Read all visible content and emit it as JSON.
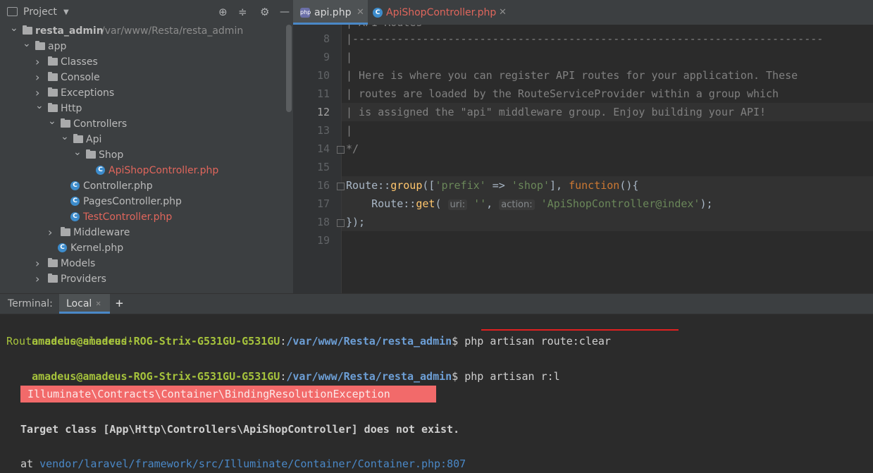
{
  "project_panel": {
    "title": "Project",
    "tree": [
      {
        "label": "resta_admin",
        "path": "/var/www/Resta/resta_admin",
        "level": 0,
        "type": "folder",
        "expanded": true
      },
      {
        "label": "app",
        "level": 1,
        "type": "folder",
        "expanded": true
      },
      {
        "label": "Classes",
        "level": 2,
        "type": "folder",
        "expanded": false
      },
      {
        "label": "Console",
        "level": 2,
        "type": "folder",
        "expanded": false
      },
      {
        "label": "Exceptions",
        "level": 2,
        "type": "folder",
        "expanded": false
      },
      {
        "label": "Http",
        "level": 2,
        "type": "folder",
        "expanded": true
      },
      {
        "label": "Controllers",
        "level": 3,
        "type": "folder",
        "expanded": true
      },
      {
        "label": "Api",
        "level": 4,
        "type": "folder",
        "expanded": true
      },
      {
        "label": "Shop",
        "level": 5,
        "type": "folder",
        "expanded": true
      },
      {
        "label": "ApiShopController.php",
        "level": 6,
        "type": "file",
        "color": "#e0665c"
      },
      {
        "label": "Controller.php",
        "level": 4,
        "type": "file"
      },
      {
        "label": "PagesController.php",
        "level": 4,
        "type": "file"
      },
      {
        "label": "TestController.php",
        "level": 4,
        "type": "file",
        "color": "#e0665c"
      },
      {
        "label": "Middleware",
        "level": 3,
        "type": "folder",
        "expanded": false
      },
      {
        "label": "Kernel.php",
        "level": 3,
        "type": "file"
      },
      {
        "label": "Models",
        "level": 2,
        "type": "folder",
        "expanded": false
      },
      {
        "label": "Providers",
        "level": 2,
        "type": "folder",
        "expanded": false
      }
    ]
  },
  "editor_tabs": [
    {
      "label": "api.php",
      "active": true
    },
    {
      "label": "ApiShopController.php",
      "active": false
    }
  ],
  "editor": {
    "lines": [
      {
        "num": "8",
        "text": "|--------------------------------------------------------------------------"
      },
      {
        "num": "9",
        "text": "|"
      },
      {
        "num": "10",
        "text": "| Here is where you can register API routes for your application. These"
      },
      {
        "num": "11",
        "text": "| routes are loaded by the RouteServiceProvider within a group which"
      },
      {
        "num": "12",
        "text": "| is assigned the \"api\" middleware group. Enjoy building your API!"
      },
      {
        "num": "13",
        "text": "|"
      },
      {
        "num": "14",
        "text": "*/"
      },
      {
        "num": "15",
        "text": ""
      },
      {
        "num": "16",
        "text": "Route::group(['prefix' => 'shop'], function(){"
      },
      {
        "num": "17",
        "text": "    Route::get( uri: '', action: 'ApiShopController@index');"
      },
      {
        "num": "18",
        "text": "});"
      },
      {
        "num": "19",
        "text": ""
      }
    ],
    "top_partial": "| API Routes",
    "code16": {
      "cls": "Route",
      "sep": "::",
      "method": "group",
      "open": "([",
      "key": "'prefix'",
      "arrow": " => ",
      "val": "'shop'",
      "close": "], ",
      "kw": "function",
      "end": "(){"
    },
    "code17": {
      "indent": "    ",
      "cls": "Route",
      "sep": "::",
      "method": "get",
      "open": "( ",
      "hint1": "uri:",
      "arg1": "''",
      "comma": ", ",
      "hint2": "action:",
      "arg2": "'ApiShopController@index'",
      "end": ");"
    },
    "code18": "});"
  },
  "terminal": {
    "label": "Terminal:",
    "tab": "Local",
    "user": "amadeus@amadeus-ROG-Strix-G531GU-G531GU",
    "colon": ":",
    "path": "/var/www/Resta/resta_admin",
    "dollar": "$",
    "cmd1": " php artisan route:clear",
    "out1": "Route cache cleared!",
    "cmd2": " php artisan r:l",
    "exception": "Illuminate\\Contracts\\Container\\BindingResolutionException",
    "message": "Target class [App\\Http\\Controllers\\ApiShopController] does not exist.",
    "trace_partial": "at vendor/laravel/framework/src/Illuminate/Container/Container.php:807"
  },
  "colors": {
    "accent": "#4a88c7",
    "error_bg": "#f26a6a",
    "prompt_user": "#a6c33c",
    "prompt_path": "#6d9fd6",
    "modified_file": "#e0665c"
  }
}
